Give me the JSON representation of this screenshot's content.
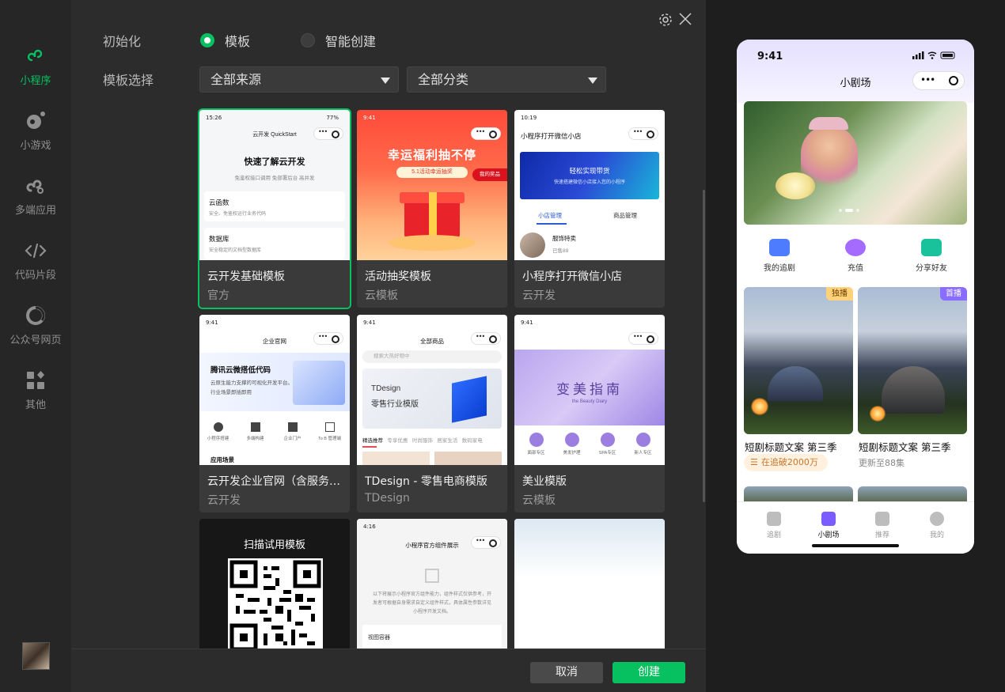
{
  "nav": {
    "items": [
      {
        "label": "小程序",
        "icon": "miniprogram-icon",
        "active": true
      },
      {
        "label": "小游戏",
        "icon": "minigame-icon",
        "active": false
      },
      {
        "label": "多端应用",
        "icon": "multiplatform-icon",
        "active": false
      },
      {
        "label": "代码片段",
        "icon": "code-icon",
        "active": false
      },
      {
        "label": "公众号网页",
        "icon": "official-account-icon",
        "active": false
      },
      {
        "label": "其他",
        "icon": "grid-icon",
        "active": false
      }
    ]
  },
  "form": {
    "init_label": "初始化",
    "init_options": [
      {
        "label": "模板",
        "selected": true
      },
      {
        "label": "智能创建",
        "selected": false
      }
    ],
    "template_label": "模板选择",
    "source_select": "全部来源",
    "category_select": "全部分类"
  },
  "templates": [
    {
      "title": "云开发基础模板",
      "source": "官方",
      "selected": true
    },
    {
      "title": "活动抽奖模板",
      "source": "云模板"
    },
    {
      "title": "小程序打开微信小店",
      "source": "云开发"
    },
    {
      "title": "云开发企业官网（含服务…",
      "source": "云开发"
    },
    {
      "title": "TDesign - 零售电商模版",
      "source": "TDesign"
    },
    {
      "title": "美业模版",
      "source": "云模板"
    },
    {
      "title": "",
      "source": ""
    },
    {
      "title": "",
      "source": ""
    },
    {
      "title": "",
      "source": ""
    }
  ],
  "thumbs": {
    "t1": {
      "time": "15:26",
      "battery": "77%",
      "app": "云开发 QuickStart",
      "headline": "快速了解云开发",
      "desc": "免鉴权接口调用 免部署后台 高并发",
      "row1_title": "云函数",
      "row1_desc": "安全、免鉴权运行业务代码",
      "row2_title": "数据库",
      "row2_desc": "安全稳定的文档型数据库"
    },
    "t2": {
      "time": "9:41",
      "headline": "幸运福利抽不停",
      "badge": "5.1活动幸运抽奖",
      "side": "我的奖品"
    },
    "t3": {
      "time": "10:19",
      "app": "小程序打开微信小店",
      "banner_title": "轻松实现带货",
      "banner_sub": "快速搭建微信小店接入您的小程序",
      "tab1": "小店管理",
      "tab2": "商品管理",
      "item": "服饰特卖",
      "item_sub": "已售89"
    },
    "t4": {
      "time": "9:41",
      "app": "企业官网",
      "headline": "腾讯云微搭低代码",
      "desc1": "云原生能力支撑的可视化开发平台。",
      "desc2": "行业场景即插即用",
      "icons": [
        "小程序搭建",
        "多端构建",
        "企业门户",
        "To B 管理端"
      ],
      "section": "应用场景"
    },
    "t5": {
      "time": "9:41",
      "app": "全部商品",
      "search": "搜索大热好物中",
      "banner1": "TDesign",
      "banner2": "零售行业模版",
      "tabs": [
        "精选推荐",
        "专享优惠",
        "时尚服饰",
        "居家生活",
        "数码家电"
      ]
    },
    "t6": {
      "time": "9:41",
      "headline": "变美指南",
      "sub": "the Beauty Diary",
      "icons": [
        "面部专区",
        "美发护理",
        "SPA专区",
        "新人专区"
      ]
    },
    "t7": {
      "headline": "扫描试用模板"
    },
    "t8": {
      "time": "4:16",
      "app": "小程序官方组件展示",
      "desc": "以下将展示小程序官方组件能力，组件样式仅供参考，开发者可根据自身需求自定义组件样式，具体属性参数详见 小程序开发文档。",
      "row": "视图容器"
    }
  },
  "footer": {
    "cancel": "取消",
    "create": "创建"
  },
  "preview": {
    "time": "9:41",
    "title": "小剧场",
    "quick": [
      {
        "label": "我的追剧",
        "color": "#4e7cff"
      },
      {
        "label": "充值",
        "color": "#a56bff"
      },
      {
        "label": "分享好友",
        "color": "#19c29a"
      }
    ],
    "dramas": [
      {
        "title": "短剧标题文案 第三季",
        "tag": "独播",
        "tag_bg": "#ffd27a",
        "tag_fg": "#6b3e00",
        "status": "在追破2000万"
      },
      {
        "title": "短剧标题文案 第三季",
        "tag": "首播",
        "tag_bg": "#8a6cff",
        "tag_fg": "#ffffff",
        "status": "更新至88集"
      }
    ],
    "tabs": [
      {
        "label": "追剧",
        "active": false
      },
      {
        "label": "小剧场",
        "active": true
      },
      {
        "label": "推荐",
        "active": false
      },
      {
        "label": "我的",
        "active": false
      }
    ]
  }
}
